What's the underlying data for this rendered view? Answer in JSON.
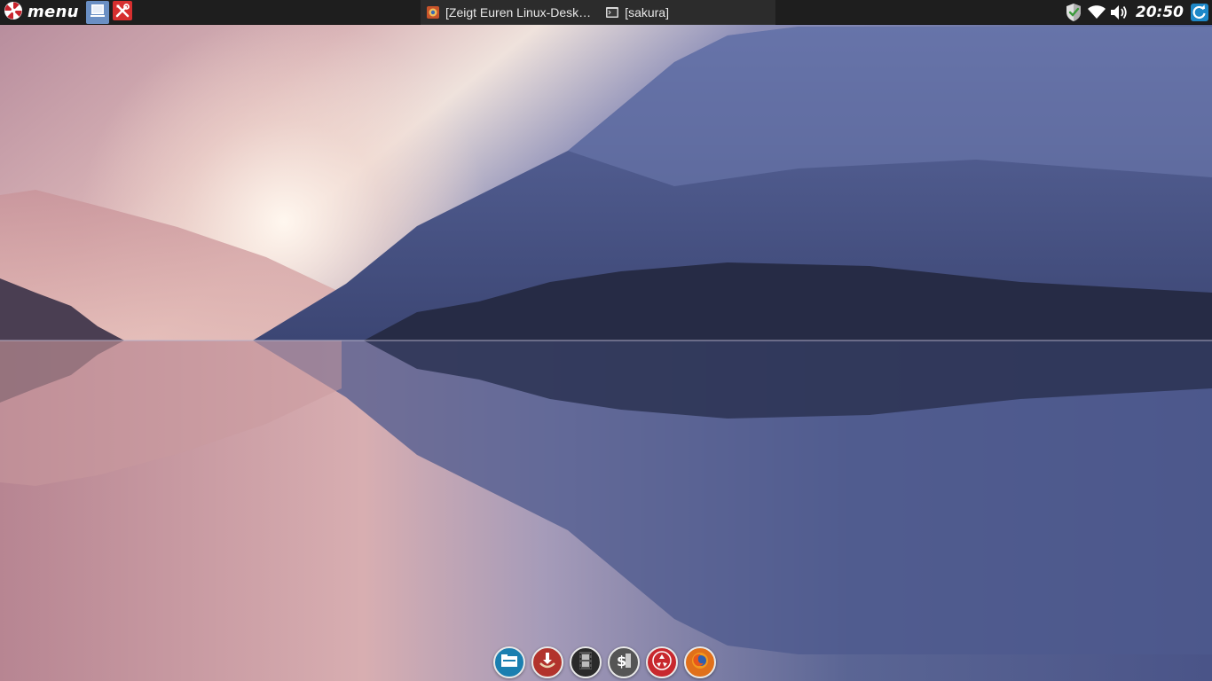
{
  "top_panel": {
    "menu": {
      "label": "menu",
      "icon": "peppermint-logo-icon"
    },
    "launchers": [
      {
        "name": "show-desktop",
        "icon": "desktop-icon",
        "active": true
      },
      {
        "name": "system-tools",
        "icon": "tools-icon",
        "active": false
      }
    ],
    "tasks": [
      {
        "label": "[Zeigt Euren Linux-Desk…",
        "icon": "browser-icon"
      },
      {
        "label": "[sakura]",
        "icon": "terminal-icon"
      }
    ],
    "tray": {
      "icons": [
        "shield-icon",
        "wifi-icon",
        "volume-icon"
      ],
      "clock": "20:50",
      "update_icon": "update-icon"
    }
  },
  "dock": {
    "items": [
      {
        "name": "file-manager",
        "icon": "folder-icon",
        "color": "#1a7fb0"
      },
      {
        "name": "downloader",
        "icon": "download-icon",
        "color": "#b2332c"
      },
      {
        "name": "media",
        "icon": "film-icon",
        "color": "#2a2a2a"
      },
      {
        "name": "terminal",
        "icon": "terminal-dollar-icon",
        "color": "#555555"
      },
      {
        "name": "trash",
        "icon": "recycle-icon",
        "color": "#c8282e"
      },
      {
        "name": "firefox",
        "icon": "firefox-icon",
        "color": "#e0701a"
      }
    ]
  },
  "colors": {
    "panel": "#1e1e1e",
    "taskbar": "#2c2c2c",
    "active_launcher": "#6a8fc4"
  }
}
